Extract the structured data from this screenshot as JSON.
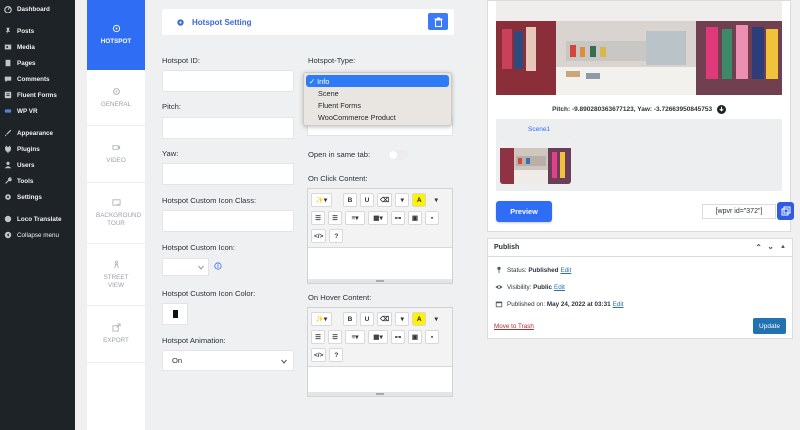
{
  "wp_menu": [
    {
      "label": "Dashboard",
      "icon": "dashboard-icon"
    },
    {
      "label": "Posts",
      "icon": "pin-icon"
    },
    {
      "label": "Media",
      "icon": "media-icon"
    },
    {
      "label": "Pages",
      "icon": "pages-icon"
    },
    {
      "label": "Comments",
      "icon": "comments-icon"
    },
    {
      "label": "Fluent Forms",
      "icon": "forms-icon"
    },
    {
      "label": "WP VR",
      "icon": "vr-icon"
    },
    {
      "label": "Appearance",
      "icon": "brush-icon"
    },
    {
      "label": "Plugins",
      "icon": "plugin-icon"
    },
    {
      "label": "Users",
      "icon": "user-icon"
    },
    {
      "label": "Tools",
      "icon": "wrench-icon"
    },
    {
      "label": "Settings",
      "icon": "settings-icon"
    },
    {
      "label": "Loco Translate",
      "icon": "translate-icon"
    },
    {
      "label": "Collapse menu",
      "icon": "collapse-icon"
    }
  ],
  "tabs": [
    {
      "label": "HOTSPOT",
      "active": true
    },
    {
      "label": "GENERAL"
    },
    {
      "label": "VIDEO"
    },
    {
      "label": "BACKGROUND TOUR"
    },
    {
      "label": "STREET VIEW"
    },
    {
      "label": "EXPORT"
    }
  ],
  "panel": {
    "title": "Hotspot Setting",
    "hotspot_id_label": "Hotspot ID:",
    "pitch_label": "Pitch:",
    "yaw_label": "Yaw:",
    "custom_icon_class_label": "Hotspot Custom Icon Class:",
    "custom_icon_label": "Hotspot Custom Icon:",
    "custom_icon_color_label": "Hotspot Custom Icon Color:",
    "animation_label": "Hotspot Animation:",
    "animation_value": "On",
    "type_label": "Hotspot-Type:",
    "type_options": [
      "Info",
      "Scene",
      "Fluent Forms",
      "WooCommerce Product"
    ],
    "type_selected": "Info",
    "open_same_tab_label": "Open in same tab:",
    "on_click_label": "On Click Content:",
    "on_hover_label": "On Hover Content:"
  },
  "editor_toolbar": {
    "bold": "B",
    "underline": "U",
    "help": "?",
    "code": "</>"
  },
  "preview": {
    "coords": "Pitch: -9.890280363677123, Yaw: -3.72663950845753",
    "scene_label": "Scene1",
    "preview_button": "Preview",
    "shortcode": "[wpvr id=\"372\"]"
  },
  "publish": {
    "title": "Publish",
    "status_label": "Status:",
    "status_value": "Published",
    "visibility_label": "Visibility:",
    "visibility_value": "Public",
    "published_label": "Published on:",
    "published_value": "May 24, 2022 at 03:31",
    "edit": "Edit",
    "trash": "Move to Trash",
    "update": "Update"
  },
  "colors": {
    "accent": "#2f6df5",
    "wp_sidebar": "#1d2327",
    "wp_blue": "#2271b1"
  }
}
